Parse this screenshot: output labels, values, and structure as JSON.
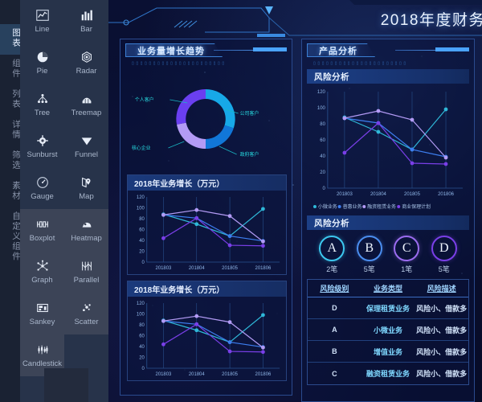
{
  "rail": {
    "items": [
      {
        "label": "图表",
        "active": true
      },
      {
        "label": "组件",
        "active": false
      },
      {
        "label": "列表",
        "active": false
      },
      {
        "label": "详情",
        "active": false
      },
      {
        "label": "筛选",
        "active": false
      },
      {
        "label": "素材",
        "active": false
      },
      {
        "label": "自定义组件",
        "active": false
      }
    ]
  },
  "palette": {
    "items": [
      {
        "label": "Line",
        "icon": "line-chart-icon",
        "selected": false
      },
      {
        "label": "Bar",
        "icon": "bar-chart-icon",
        "selected": false
      },
      {
        "label": "Pie",
        "icon": "pie-chart-icon",
        "selected": false
      },
      {
        "label": "Radar",
        "icon": "radar-chart-icon",
        "selected": false
      },
      {
        "label": "Tree",
        "icon": "tree-chart-icon",
        "selected": false
      },
      {
        "label": "Treemap",
        "icon": "treemap-icon",
        "selected": false
      },
      {
        "label": "Sunburst",
        "icon": "sunburst-icon",
        "selected": false
      },
      {
        "label": "Funnel",
        "icon": "funnel-icon",
        "selected": false
      },
      {
        "label": "Gauge",
        "icon": "gauge-icon",
        "selected": false
      },
      {
        "label": "Map",
        "icon": "map-icon",
        "selected": false
      },
      {
        "label": "Boxplot",
        "icon": "boxplot-icon",
        "selected": true
      },
      {
        "label": "Heatmap",
        "icon": "heatmap-icon",
        "selected": true
      },
      {
        "label": "Graph",
        "icon": "graph-icon",
        "selected": true
      },
      {
        "label": "Parallel",
        "icon": "parallel-icon",
        "selected": true
      },
      {
        "label": "Sankey",
        "icon": "sankey-icon",
        "selected": true
      },
      {
        "label": "Scatter",
        "icon": "scatter-icon",
        "selected": true
      },
      {
        "label": "Candlestick",
        "icon": "candlestick-icon",
        "selected": true
      }
    ]
  },
  "header": {
    "title": "2018年度财务"
  },
  "left_panel": {
    "title": "业务量增长趋势",
    "donut_labels": [
      "个人客户",
      "公司客户",
      "政府客户",
      "核心企业"
    ],
    "cards": [
      {
        "title": "2018年业务增长（万元）"
      },
      {
        "title": "2018年业务增长（万元）"
      }
    ]
  },
  "right_panel": {
    "title": "产品分析",
    "risk_chart_title": "风险分析",
    "risk_grade_title": "风险分析",
    "grades": [
      {
        "letter": "A",
        "count": "2笔",
        "color": "#3cc8ef"
      },
      {
        "letter": "B",
        "count": "5笔",
        "color": "#4b8ef0"
      },
      {
        "letter": "C",
        "count": "1笔",
        "color": "#9b6cf0"
      },
      {
        "letter": "D",
        "count": "5笔",
        "color": "#7a3fe8"
      }
    ],
    "table": {
      "headers": [
        "风险级别",
        "业务类型",
        "风险描述"
      ],
      "rows": [
        {
          "grade": "D",
          "biz": "保理租赁业务",
          "desc": "风险小、借款多"
        },
        {
          "grade": "A",
          "biz": "小微业务",
          "desc": "风险小、借款多"
        },
        {
          "grade": "B",
          "biz": "增值业务",
          "desc": "风险小、借款多"
        },
        {
          "grade": "C",
          "biz": "融资租赁业务",
          "desc": "风险小、借款多"
        }
      ]
    }
  },
  "chart_data": [
    {
      "type": "pie",
      "name": "业务量增长趋势",
      "title": "业务量增长趋势",
      "labels": [
        "个人客户",
        "公司客户",
        "核心企业",
        "政府客户"
      ],
      "values": [
        30,
        20,
        22,
        28
      ],
      "colors": [
        "#17a9e8",
        "#1177d8",
        "#b39bf5",
        "#6a3ff0"
      ],
      "legend": "labels-outside",
      "grid": false
    },
    {
      "type": "line",
      "name": "2018年业务增长（万元）- 上",
      "title": "2018年业务增长（万元）",
      "categories": [
        "201803",
        "201804",
        "201805",
        "201806"
      ],
      "xlabel": "",
      "ylabel": "",
      "ylim": [
        0,
        120
      ],
      "yticks": [
        0,
        20,
        40,
        60,
        80,
        100,
        120
      ],
      "grid": true,
      "series": [
        {
          "name": "小微业务",
          "values": [
            88,
            70,
            48,
            98
          ],
          "color": "#2fb8d8"
        },
        {
          "name": "普惠业务",
          "values": [
            87,
            81,
            48,
            39
          ],
          "color": "#3d7ef0"
        },
        {
          "name": "融资租赁业务",
          "values": [
            87,
            96,
            85,
            38
          ],
          "color": "#b39bf5"
        },
        {
          "name": "商业保理计划",
          "values": [
            44,
            81,
            31,
            30
          ],
          "color": "#7a3fe8"
        }
      ]
    },
    {
      "type": "line",
      "name": "2018年业务增长（万元）- 下",
      "title": "2018年业务增长（万元）",
      "categories": [
        "201803",
        "201804",
        "201805",
        "201806"
      ],
      "xlabel": "",
      "ylabel": "",
      "ylim": [
        0,
        120
      ],
      "yticks": [
        0,
        20,
        40,
        60,
        80,
        100,
        120
      ],
      "grid": true,
      "series": [
        {
          "name": "小微业务",
          "values": [
            88,
            70,
            48,
            98
          ],
          "color": "#2fb8d8"
        },
        {
          "name": "普惠业务",
          "values": [
            87,
            81,
            48,
            39
          ],
          "color": "#3d7ef0"
        },
        {
          "name": "融资租赁业务",
          "values": [
            87,
            96,
            85,
            38
          ],
          "color": "#b39bf5"
        },
        {
          "name": "商业保理计划",
          "values": [
            44,
            81,
            31,
            30
          ],
          "color": "#7a3fe8"
        }
      ]
    },
    {
      "type": "line",
      "name": "风险分析",
      "title": "风险分析",
      "categories": [
        "201803",
        "201804",
        "201805",
        "201806"
      ],
      "xlabel": "",
      "ylabel": "",
      "ylim": [
        0,
        120
      ],
      "yticks": [
        0,
        20,
        40,
        60,
        80,
        100,
        120
      ],
      "grid": true,
      "legend_position": "bottom",
      "series": [
        {
          "name": "小微业务",
          "values": [
            88,
            70,
            48,
            98
          ],
          "color": "#2fb8d8"
        },
        {
          "name": "普惠业务",
          "values": [
            87,
            81,
            48,
            39
          ],
          "color": "#3d7ef0"
        },
        {
          "name": "融资租赁业务",
          "values": [
            87,
            96,
            85,
            38
          ],
          "color": "#b39bf5"
        },
        {
          "name": "商业保理计划",
          "values": [
            44,
            81,
            31,
            30
          ],
          "color": "#7a3fe8"
        }
      ]
    }
  ]
}
